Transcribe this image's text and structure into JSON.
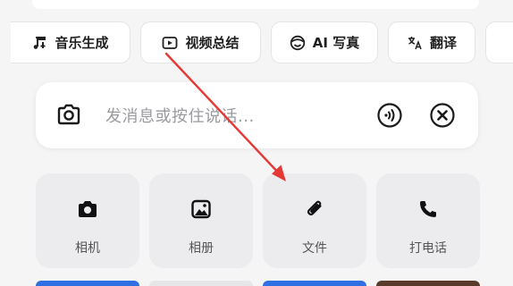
{
  "quick_actions": [
    {
      "label": "音乐生成",
      "icon": "music-note-icon"
    },
    {
      "label": "视频总结",
      "icon": "video-summary-icon"
    },
    {
      "label": "AI 写真",
      "icon": "smiley-face-icon"
    },
    {
      "label": "翻译",
      "icon": "translate-icon"
    }
  ],
  "input": {
    "placeholder": "发消息或按住说话...",
    "camera_icon": "camera-icon",
    "voice_icon": "voice-wave-icon",
    "close_icon": "close-circle-icon"
  },
  "attachments": [
    {
      "label": "相机",
      "icon": "camera-filled-icon"
    },
    {
      "label": "相册",
      "icon": "image-icon"
    },
    {
      "label": "文件",
      "icon": "paperclip-icon"
    },
    {
      "label": "打电话",
      "icon": "phone-icon"
    }
  ],
  "colors": {
    "annotation_arrow": "#e53935",
    "bottom_bar_blue": "#2f6fe4",
    "bottom_bar_light": "#e6e6e8",
    "bottom_bar_dark": "#5a3a2a"
  }
}
